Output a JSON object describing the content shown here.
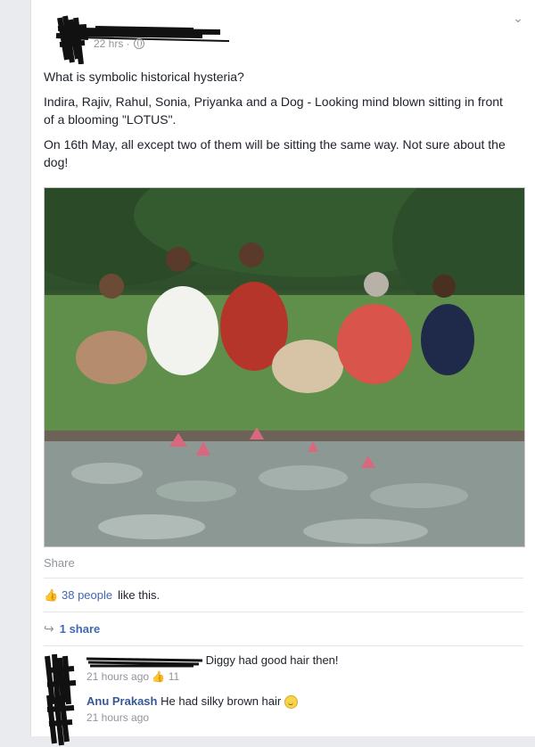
{
  "post": {
    "timestamp": "22 hrs ·",
    "text_1": "What is symbolic historical hysteria?",
    "text_2": "Indira, Rajiv, Rahul, Sonia, Priyanka and a Dog - Looking mind blown sitting in front of a blooming \"LOTUS\".",
    "text_3": "On 16th May, all except two of them will be sitting the same way. Not sure about the dog!"
  },
  "actions": {
    "share_label": "Share"
  },
  "engagement": {
    "likes_count": "38 people",
    "likes_suffix": "like this.",
    "shares": "1 share"
  },
  "comments": [
    {
      "author": "",
      "text": "Diggy had good hair then!",
      "time": "21 hours ago",
      "likes": "11"
    },
    {
      "author": "Anu Prakash",
      "text": "He had silky brown hair",
      "time": "21 hours ago"
    }
  ],
  "icons": {
    "like": "thumbs-up-icon",
    "share": "share-arrow-icon",
    "emoji": "smile-icon",
    "privacy": "globe-icon",
    "menu": "chevron-down-icon"
  },
  "colors": {
    "link": "#4267b2",
    "meta": "#90949c",
    "text": "#1d2129",
    "background": "#e9ebee"
  }
}
